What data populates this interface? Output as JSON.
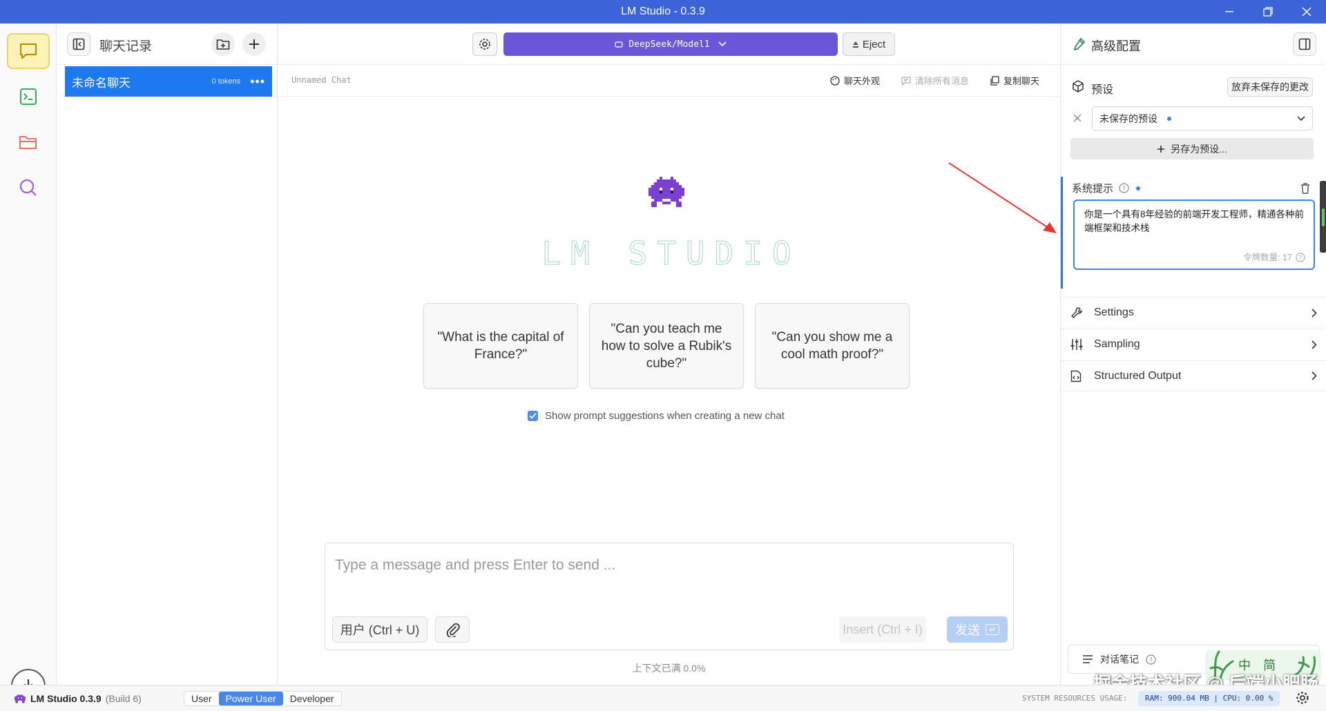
{
  "window": {
    "title": "LM Studio - 0.3.9"
  },
  "chat_list": {
    "title": "聊天记录",
    "items": [
      {
        "name": "未命名聊天",
        "tokens": "0 tokens"
      }
    ]
  },
  "toolbar": {
    "model_label": "DeepSeek/Model1",
    "eject_label": "Eject"
  },
  "chat": {
    "name": "Unnamed Chat",
    "actions": {
      "appearance": "聊天外观",
      "clear": "清除所有消息",
      "copy": "复制聊天"
    },
    "logo_text": "LM STUDIO",
    "suggestions": [
      "\"What is the capital of France?\"",
      "\"Can you teach me how to solve a Rubik's cube?\"",
      "\"Can you show me a cool math proof?\""
    ],
    "show_suggestions_label": "Show prompt suggestions when creating a new chat"
  },
  "composer": {
    "placeholder": "Type a message and press Enter to send ...",
    "role_label": "用户 (Ctrl + U)",
    "insert_label": "Insert (Ctrl + I)",
    "send_label": "发送",
    "send_key": "↵",
    "context_usage": "上下文已满 0.0%"
  },
  "config": {
    "title": "高级配置",
    "preset": {
      "label": "预设",
      "discard_label": "放弃未保存的更改",
      "current": "未保存的预设",
      "save_as_label": "另存为预设..."
    },
    "system_prompt": {
      "label": "系统提示",
      "text": "你是一个具有8年经验的前端开发工程师，精通各种前端框架和技术栈",
      "token_count": "令牌数量: 17"
    },
    "sections": [
      "Settings",
      "Sampling",
      "Structured Output"
    ],
    "notes_label": "对话笔记"
  },
  "ime": {
    "lang": "中",
    "mode": "简"
  },
  "watermark": "掘金技术社区 @ 后端小肥肠",
  "statusbar": {
    "app_name": "LM Studio 0.3.9",
    "build": "(Build 6)",
    "modes": [
      "User",
      "Power User",
      "Developer"
    ],
    "active_mode": "Power User",
    "resources_label": "SYSTEM RESOURCES USAGE:",
    "resources_value": "RAM: 900.04 MB  |  CPU: 0.00 %"
  },
  "colors": {
    "titlebar": "#3d63d8",
    "model_button": "#6b55d9",
    "selected_chat": "#1e78f0",
    "accent": "#3b82f6"
  }
}
